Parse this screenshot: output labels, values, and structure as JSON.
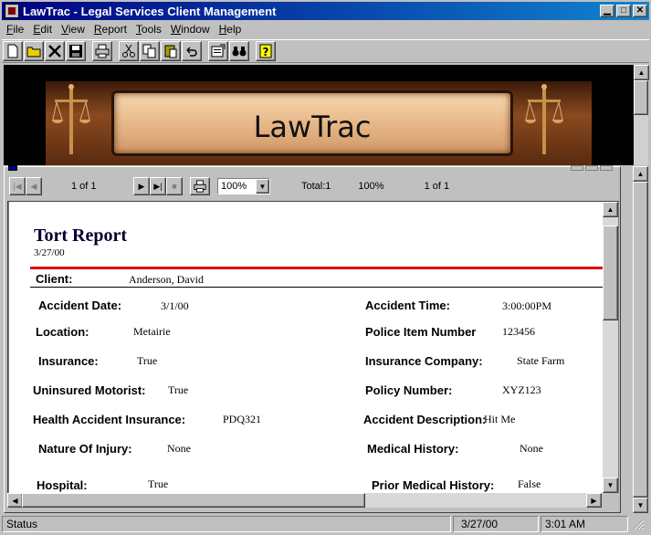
{
  "window": {
    "title": "LawTrac - Legal Services Client Management"
  },
  "menu": [
    {
      "label": "File",
      "key": "F",
      "rest": "ile"
    },
    {
      "label": "Edit",
      "key": "E",
      "rest": "dit"
    },
    {
      "label": "View",
      "key": "V",
      "rest": "iew"
    },
    {
      "label": "Report",
      "key": "R",
      "rest": "eport"
    },
    {
      "label": "Tools",
      "key": "T",
      "rest": "ools"
    },
    {
      "label": "Window",
      "key": "W",
      "rest": "indow"
    },
    {
      "label": "Help",
      "key": "H",
      "rest": "elp"
    }
  ],
  "banner": {
    "title": "LawTrac"
  },
  "viewer": {
    "page_indicator": "1 of 1",
    "zoom": "100%",
    "total": "Total:1",
    "percent": "100%",
    "page_count": "1 of 1"
  },
  "report": {
    "title": "Tort Report",
    "date": "3/27/00",
    "client_label": "Client:",
    "client_value": "Anderson,  David",
    "fields": {
      "accident_date": {
        "label": "Accident Date:",
        "value": "3/1/00"
      },
      "accident_time": {
        "label": "Accident Time:",
        "value": "3:00:00PM"
      },
      "location": {
        "label": "Location:",
        "value": "Metairie"
      },
      "police_item": {
        "label": "Police Item Number",
        "value": "123456"
      },
      "insurance": {
        "label": "Insurance:",
        "value": "True"
      },
      "insurance_company": {
        "label": "Insurance Company:",
        "value": "State Farm"
      },
      "uninsured": {
        "label": "Uninsured Motorist:",
        "value": "True"
      },
      "policy_number": {
        "label": "Policy Number:",
        "value": "XYZ123"
      },
      "health_insurance": {
        "label": "Health Accident Insurance:",
        "value": "PDQ321"
      },
      "accident_description": {
        "label": "Accident Description:",
        "value": "Hit Me"
      },
      "nature_injury": {
        "label": "Nature Of Injury:",
        "value": "None"
      },
      "medical_history": {
        "label": "Medical History:",
        "value": "None"
      },
      "hospital": {
        "label": "Hospital:",
        "value": "True"
      },
      "prior_medical": {
        "label": "Prior Medical History:",
        "value": "False"
      }
    }
  },
  "status": {
    "text": "Status",
    "date": "3/27/00",
    "time": "3:01 AM"
  }
}
